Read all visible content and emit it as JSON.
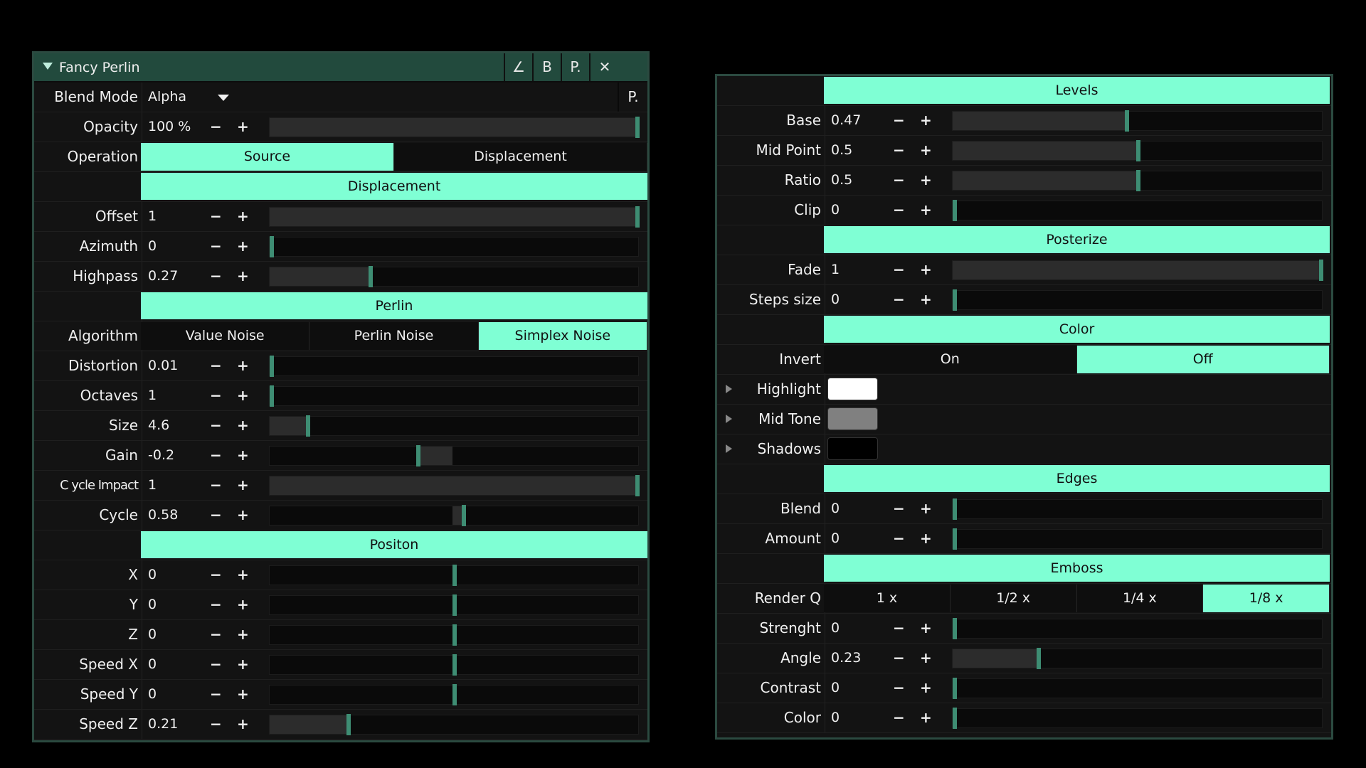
{
  "colors": {
    "accent": "#7fffd4",
    "panel": "#131313",
    "border": "#2b4a40",
    "handle": "#3e8d73"
  },
  "left": {
    "title": "Fancy Perlin",
    "title_buttons": [
      {
        "icon": "angle-icon",
        "glyph": "∠"
      },
      {
        "icon": "b-icon",
        "glyph": "B"
      },
      {
        "icon": "p-icon",
        "glyph": "P."
      },
      {
        "icon": "close-icon",
        "glyph": "✕"
      }
    ],
    "blend_mode": {
      "label": "Blend Mode",
      "value": "Alpha",
      "p_label": "P."
    },
    "opacity": {
      "label": "Opacity",
      "value": "100 %",
      "level": 1.0
    },
    "operation": {
      "label": "Operation",
      "options": [
        "Source",
        "Displacement"
      ],
      "selected": 0
    },
    "section_displacement": "Displacement",
    "offset": {
      "label": "Offset",
      "value": "1",
      "level": 1.0
    },
    "azimuth": {
      "label": "Azimuth",
      "value": "0",
      "level": 0.0
    },
    "highpass": {
      "label": "Highpass",
      "value": "0.27",
      "level": 0.27
    },
    "section_perlin": "Perlin",
    "algorithm": {
      "label": "Algorithm",
      "options": [
        "Value Noise",
        "Perlin Noise",
        "Simplex Noise"
      ],
      "selected": 2
    },
    "distortion": {
      "label": "Distortion",
      "value": "0.01",
      "level": 0.0
    },
    "octaves": {
      "label": "Octaves",
      "value": "1",
      "level": 0.0
    },
    "size": {
      "label": "Size",
      "value": "4.6",
      "level": 0.1
    },
    "gain": {
      "label": "Gain",
      "value": "-0.2",
      "level": -0.2
    },
    "cycle_impact": {
      "label": "C ycle Impact",
      "value": "1",
      "level": 1.0
    },
    "cycle": {
      "label": "Cycle",
      "value": "0.58",
      "level": 0.05
    },
    "section_position": "Positon",
    "x": {
      "label": "X",
      "value": "0",
      "level": 0.0
    },
    "y": {
      "label": "Y",
      "value": "0",
      "level": 0.0
    },
    "z": {
      "label": "Z",
      "value": "0",
      "level": 0.0
    },
    "speed_x": {
      "label": "Speed X",
      "value": "0",
      "level": 0.0
    },
    "speed_y": {
      "label": "Speed Y",
      "value": "0",
      "level": 0.0
    },
    "speed_z": {
      "label": "Speed Z",
      "value": "0.21",
      "level": 0.21
    }
  },
  "right": {
    "section_levels": "Levels",
    "base": {
      "label": "Base",
      "value": "0.47",
      "level": 0.47
    },
    "mid_point": {
      "label": "Mid Point",
      "value": "0.5",
      "level": 0.5
    },
    "ratio": {
      "label": "Ratio",
      "value": "0.5",
      "level": 0.5
    },
    "clip": {
      "label": "Clip",
      "value": "0",
      "level": 0.0
    },
    "section_posterize": "Posterize",
    "fade": {
      "label": "Fade",
      "value": "1",
      "level": 1.0
    },
    "steps_size": {
      "label": "Steps size",
      "value": "0",
      "level": 0.0
    },
    "section_color": "Color",
    "invert": {
      "label": "Invert",
      "options": [
        "On",
        "Off"
      ],
      "selected": 1
    },
    "highlight": {
      "label": "Highlight",
      "color": "#ffffff"
    },
    "mid_tone": {
      "label": "Mid Tone",
      "color": "#808080"
    },
    "shadows": {
      "label": "Shadows",
      "color": "#000000"
    },
    "section_edges": "Edges",
    "blend": {
      "label": "Blend",
      "value": "0",
      "level": 0.0
    },
    "amount": {
      "label": "Amount",
      "value": "0",
      "level": 0.0
    },
    "section_emboss": "Emboss",
    "render_q": {
      "label": "Render Q",
      "options": [
        "1 x",
        "1/2 x",
        "1/4 x",
        "1/8 x"
      ],
      "selected": 3
    },
    "strenght": {
      "label": "Strenght",
      "value": "0",
      "level": 0.0
    },
    "angle": {
      "label": "Angle",
      "value": "0.23",
      "level": 0.23
    },
    "contrast": {
      "label": "Contrast",
      "value": "0",
      "level": 0.0
    },
    "color": {
      "label": "Color",
      "value": "0",
      "level": 0.0
    }
  },
  "common": {
    "minus": "−",
    "plus": "+"
  }
}
